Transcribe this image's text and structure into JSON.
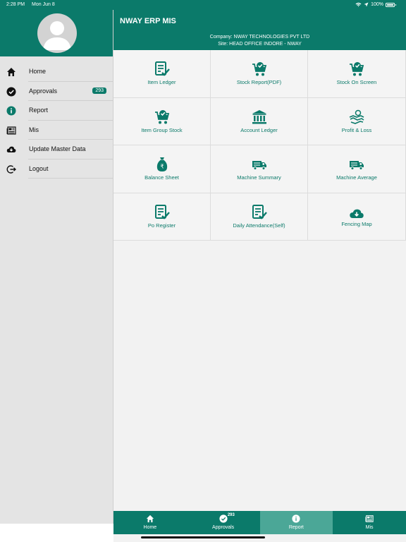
{
  "status_bar": {
    "time": "2:28 PM",
    "date": "Mon Jun 8",
    "battery": "100%"
  },
  "app": {
    "title": "NWAY ERP MIS",
    "company_line": "Company: NWAY TECHNOLOGIES PVT LTD",
    "site_line": "Site: HEAD OFFICE INDORE - NWAY"
  },
  "sidebar": {
    "items": [
      {
        "label": "Home",
        "icon": "home-icon"
      },
      {
        "label": "Approvals",
        "icon": "check-circle-icon",
        "badge": "293"
      },
      {
        "label": "Report",
        "icon": "info-icon"
      },
      {
        "label": "Mis",
        "icon": "newspaper-icon"
      },
      {
        "label": "Update Master Data",
        "icon": "cloud-download-icon"
      },
      {
        "label": "Logout",
        "icon": "logout-icon"
      }
    ]
  },
  "report_tiles": [
    {
      "label": "Item Ledger",
      "icon": "checklist-icon"
    },
    {
      "label": "Stock Report(PDF)",
      "icon": "cart-check-icon"
    },
    {
      "label": "Stock On Screen",
      "icon": "cart-check-icon"
    },
    {
      "label": "Item Group Stock",
      "icon": "cart-check-icon"
    },
    {
      "label": "Account Ledger",
      "icon": "bank-icon"
    },
    {
      "label": "Profit & Loss",
      "icon": "handshake-icon"
    },
    {
      "label": "Balance Sheet",
      "icon": "money-bag-icon"
    },
    {
      "label": "Machine Summary",
      "icon": "truck-icon"
    },
    {
      "label": "Machine Average",
      "icon": "truck-icon"
    },
    {
      "label": "Po Register",
      "icon": "checklist-icon"
    },
    {
      "label": "Daily Attendance(Self)",
      "icon": "checklist-icon"
    },
    {
      "label": "Fencing Map",
      "icon": "cloud-download-icon"
    }
  ],
  "bottom_nav": {
    "items": [
      {
        "label": "Home",
        "icon": "home-icon"
      },
      {
        "label": "Approvals",
        "icon": "check-circle-icon",
        "badge": "293"
      },
      {
        "label": "Report",
        "icon": "info-icon",
        "active": true
      },
      {
        "label": "Mis",
        "icon": "newspaper-icon"
      }
    ]
  },
  "colors": {
    "primary": "#0b7a6a",
    "active_tab": "#4ba797",
    "background": "#f2f2f2",
    "sidebar_bg": "#e4e4e4"
  }
}
